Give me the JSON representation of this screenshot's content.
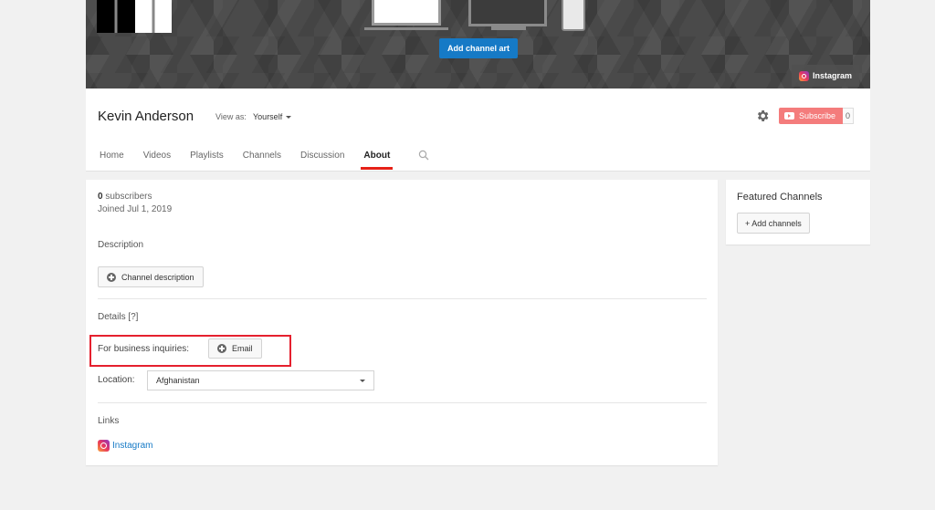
{
  "banner": {
    "add_channel_art_label": "Add channel art",
    "link_label": "Instagram",
    "link_icon": "instagram-icon"
  },
  "header": {
    "channel_name": "Kevin Anderson",
    "view_as_label": "View as:",
    "view_as_value": "Yourself",
    "settings_icon": "gear-icon",
    "subscribe_label": "Subscribe",
    "subscriber_count": "0",
    "tabs": [
      {
        "label": "Home",
        "active": false
      },
      {
        "label": "Videos",
        "active": false
      },
      {
        "label": "Playlists",
        "active": false
      },
      {
        "label": "Channels",
        "active": false
      },
      {
        "label": "Discussion",
        "active": false
      },
      {
        "label": "About",
        "active": true
      }
    ],
    "search_icon": "search-icon",
    "accent_color": "#e62117"
  },
  "about": {
    "subscribers_count": "0",
    "subscribers_suffix": " subscribers",
    "joined": "Joined Jul 1, 2019",
    "description_title": "Description",
    "channel_description_button": "Channel description",
    "details_title": "Details [?]",
    "business_label": "For business inquiries:",
    "email_button": "Email",
    "location_label": "Location:",
    "location_value": "Afghanistan",
    "links_title": "Links",
    "links": [
      {
        "label": "Instagram",
        "icon": "instagram-icon"
      }
    ]
  },
  "featured": {
    "title": "Featured Channels",
    "add_button": "+ Add channels"
  },
  "colors": {
    "link_blue": "#167ac6",
    "subscribe_red": "#f47c7c",
    "highlight_red": "#e5202e"
  }
}
